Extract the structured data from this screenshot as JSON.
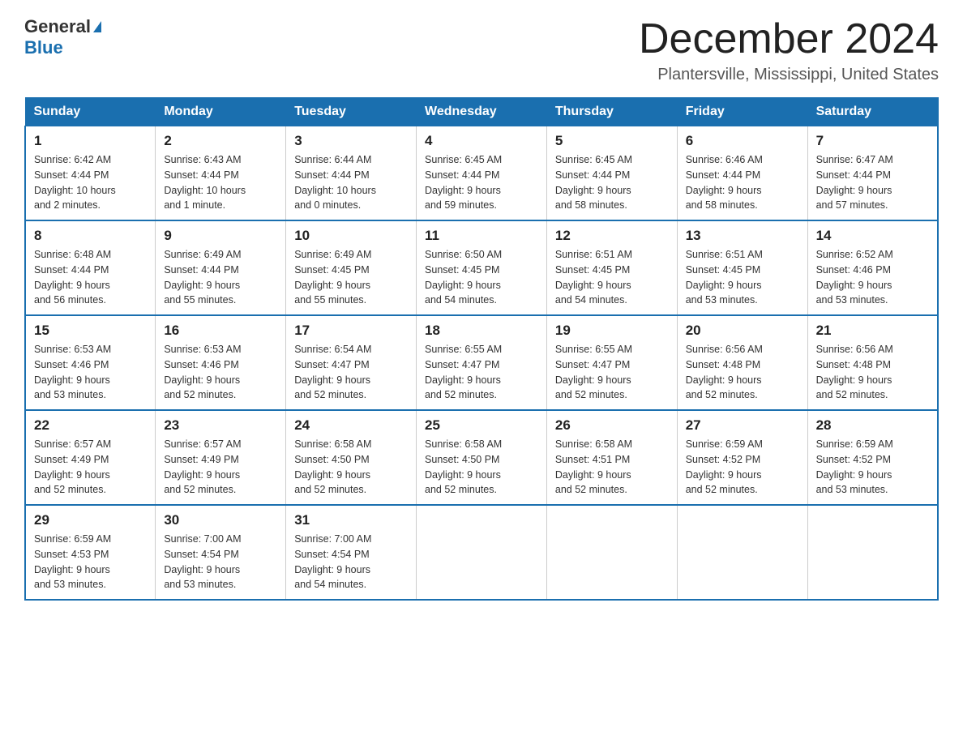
{
  "logo": {
    "general": "General",
    "blue": "Blue"
  },
  "header": {
    "title": "December 2024",
    "subtitle": "Plantersville, Mississippi, United States"
  },
  "days_of_week": [
    "Sunday",
    "Monday",
    "Tuesday",
    "Wednesday",
    "Thursday",
    "Friday",
    "Saturday"
  ],
  "weeks": [
    [
      {
        "day": "1",
        "sunrise": "6:42 AM",
        "sunset": "4:44 PM",
        "daylight": "10 hours and 2 minutes."
      },
      {
        "day": "2",
        "sunrise": "6:43 AM",
        "sunset": "4:44 PM",
        "daylight": "10 hours and 1 minute."
      },
      {
        "day": "3",
        "sunrise": "6:44 AM",
        "sunset": "4:44 PM",
        "daylight": "10 hours and 0 minutes."
      },
      {
        "day": "4",
        "sunrise": "6:45 AM",
        "sunset": "4:44 PM",
        "daylight": "9 hours and 59 minutes."
      },
      {
        "day": "5",
        "sunrise": "6:45 AM",
        "sunset": "4:44 PM",
        "daylight": "9 hours and 58 minutes."
      },
      {
        "day": "6",
        "sunrise": "6:46 AM",
        "sunset": "4:44 PM",
        "daylight": "9 hours and 58 minutes."
      },
      {
        "day": "7",
        "sunrise": "6:47 AM",
        "sunset": "4:44 PM",
        "daylight": "9 hours and 57 minutes."
      }
    ],
    [
      {
        "day": "8",
        "sunrise": "6:48 AM",
        "sunset": "4:44 PM",
        "daylight": "9 hours and 56 minutes."
      },
      {
        "day": "9",
        "sunrise": "6:49 AM",
        "sunset": "4:44 PM",
        "daylight": "9 hours and 55 minutes."
      },
      {
        "day": "10",
        "sunrise": "6:49 AM",
        "sunset": "4:45 PM",
        "daylight": "9 hours and 55 minutes."
      },
      {
        "day": "11",
        "sunrise": "6:50 AM",
        "sunset": "4:45 PM",
        "daylight": "9 hours and 54 minutes."
      },
      {
        "day": "12",
        "sunrise": "6:51 AM",
        "sunset": "4:45 PM",
        "daylight": "9 hours and 54 minutes."
      },
      {
        "day": "13",
        "sunrise": "6:51 AM",
        "sunset": "4:45 PM",
        "daylight": "9 hours and 53 minutes."
      },
      {
        "day": "14",
        "sunrise": "6:52 AM",
        "sunset": "4:46 PM",
        "daylight": "9 hours and 53 minutes."
      }
    ],
    [
      {
        "day": "15",
        "sunrise": "6:53 AM",
        "sunset": "4:46 PM",
        "daylight": "9 hours and 53 minutes."
      },
      {
        "day": "16",
        "sunrise": "6:53 AM",
        "sunset": "4:46 PM",
        "daylight": "9 hours and 52 minutes."
      },
      {
        "day": "17",
        "sunrise": "6:54 AM",
        "sunset": "4:47 PM",
        "daylight": "9 hours and 52 minutes."
      },
      {
        "day": "18",
        "sunrise": "6:55 AM",
        "sunset": "4:47 PM",
        "daylight": "9 hours and 52 minutes."
      },
      {
        "day": "19",
        "sunrise": "6:55 AM",
        "sunset": "4:47 PM",
        "daylight": "9 hours and 52 minutes."
      },
      {
        "day": "20",
        "sunrise": "6:56 AM",
        "sunset": "4:48 PM",
        "daylight": "9 hours and 52 minutes."
      },
      {
        "day": "21",
        "sunrise": "6:56 AM",
        "sunset": "4:48 PM",
        "daylight": "9 hours and 52 minutes."
      }
    ],
    [
      {
        "day": "22",
        "sunrise": "6:57 AM",
        "sunset": "4:49 PM",
        "daylight": "9 hours and 52 minutes."
      },
      {
        "day": "23",
        "sunrise": "6:57 AM",
        "sunset": "4:49 PM",
        "daylight": "9 hours and 52 minutes."
      },
      {
        "day": "24",
        "sunrise": "6:58 AM",
        "sunset": "4:50 PM",
        "daylight": "9 hours and 52 minutes."
      },
      {
        "day": "25",
        "sunrise": "6:58 AM",
        "sunset": "4:50 PM",
        "daylight": "9 hours and 52 minutes."
      },
      {
        "day": "26",
        "sunrise": "6:58 AM",
        "sunset": "4:51 PM",
        "daylight": "9 hours and 52 minutes."
      },
      {
        "day": "27",
        "sunrise": "6:59 AM",
        "sunset": "4:52 PM",
        "daylight": "9 hours and 52 minutes."
      },
      {
        "day": "28",
        "sunrise": "6:59 AM",
        "sunset": "4:52 PM",
        "daylight": "9 hours and 53 minutes."
      }
    ],
    [
      {
        "day": "29",
        "sunrise": "6:59 AM",
        "sunset": "4:53 PM",
        "daylight": "9 hours and 53 minutes."
      },
      {
        "day": "30",
        "sunrise": "7:00 AM",
        "sunset": "4:54 PM",
        "daylight": "9 hours and 53 minutes."
      },
      {
        "day": "31",
        "sunrise": "7:00 AM",
        "sunset": "4:54 PM",
        "daylight": "9 hours and 54 minutes."
      },
      null,
      null,
      null,
      null
    ]
  ],
  "labels": {
    "sunrise": "Sunrise:",
    "sunset": "Sunset:",
    "daylight": "Daylight:"
  }
}
